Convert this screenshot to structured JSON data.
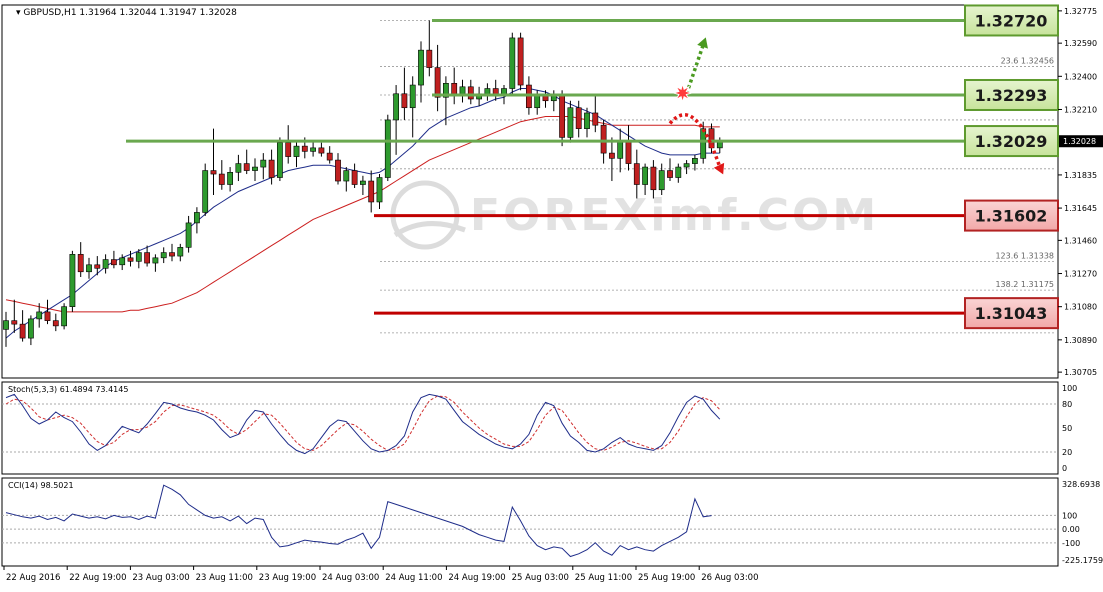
{
  "colors": {
    "bull": "#2e9a2e",
    "bear": "#c02020",
    "ma_fast": "#1f2d8a",
    "ma_slow": "#cc1f1f",
    "support": "#c00000",
    "resistance": "#6aa84f",
    "stoch_main": "#1f2d8a",
    "stoch_signal": "#d03030",
    "cci": "#1f2d8a",
    "fib": "#9a9a9a"
  },
  "chart_data": {
    "type": "candlestick",
    "header": {
      "symbol": "GBPUSD,H1",
      "open": "1.31964",
      "high": "1.32044",
      "low": "1.31947",
      "close": "1.32028"
    },
    "watermark": "FOREXimf.COM",
    "current_price": "1.32028",
    "ylim": [
      1.307,
      1.3278
    ],
    "price_ticks": [
      "1.32775",
      "1.32590",
      "1.32400",
      "1.32210",
      "1.32028",
      "1.31835",
      "1.31645",
      "1.31460",
      "1.31270",
      "1.31080",
      "1.30890",
      "1.30705"
    ],
    "x_ticks": [
      "22 Aug 2016",
      "22 Aug 19:00",
      "23 Aug 03:00",
      "23 Aug 11:00",
      "23 Aug 19:00",
      "24 Aug 03:00",
      "24 Aug 11:00",
      "24 Aug 19:00",
      "25 Aug 03:00",
      "25 Aug 11:00",
      "25 Aug 19:00",
      "26 Aug 03:00"
    ],
    "candles": [
      [
        1.3095,
        1.3105,
        1.3085,
        1.31
      ],
      [
        1.31,
        1.3112,
        1.3093,
        1.3098
      ],
      [
        1.3098,
        1.3106,
        1.3088,
        1.309
      ],
      [
        1.309,
        1.3103,
        1.3086,
        1.3101
      ],
      [
        1.3101,
        1.311,
        1.3096,
        1.3105
      ],
      [
        1.3105,
        1.3112,
        1.3098,
        1.31
      ],
      [
        1.31,
        1.3104,
        1.3094,
        1.3097
      ],
      [
        1.3097,
        1.311,
        1.3095,
        1.3108
      ],
      [
        1.3108,
        1.314,
        1.3105,
        1.3138
      ],
      [
        1.3138,
        1.3145,
        1.3125,
        1.3128
      ],
      [
        1.3128,
        1.3136,
        1.3124,
        1.3132
      ],
      [
        1.3132,
        1.3137,
        1.3126,
        1.313
      ],
      [
        1.313,
        1.3138,
        1.3127,
        1.3135
      ],
      [
        1.3135,
        1.314,
        1.313,
        1.3132
      ],
      [
        1.3132,
        1.3138,
        1.3129,
        1.3136
      ],
      [
        1.3136,
        1.314,
        1.3131,
        1.3134
      ],
      [
        1.3134,
        1.3141,
        1.313,
        1.3139
      ],
      [
        1.3139,
        1.3143,
        1.3131,
        1.3133
      ],
      [
        1.3133,
        1.3138,
        1.3128,
        1.3136
      ],
      [
        1.3136,
        1.3142,
        1.3133,
        1.3139
      ],
      [
        1.3139,
        1.3144,
        1.3134,
        1.3137
      ],
      [
        1.3137,
        1.3144,
        1.3134,
        1.3142
      ],
      [
        1.3142,
        1.316,
        1.3139,
        1.3156
      ],
      [
        1.3156,
        1.3165,
        1.315,
        1.3162
      ],
      [
        1.3162,
        1.319,
        1.316,
        1.3186
      ],
      [
        1.3186,
        1.321,
        1.3172,
        1.3184
      ],
      [
        1.3184,
        1.3192,
        1.3175,
        1.3178
      ],
      [
        1.3178,
        1.3188,
        1.3174,
        1.3185
      ],
      [
        1.3185,
        1.3195,
        1.318,
        1.319
      ],
      [
        1.319,
        1.3198,
        1.3184,
        1.3186
      ],
      [
        1.3186,
        1.3193,
        1.318,
        1.3188
      ],
      [
        1.3188,
        1.3196,
        1.3181,
        1.3192
      ],
      [
        1.3192,
        1.3198,
        1.3178,
        1.3182
      ],
      [
        1.3182,
        1.3205,
        1.318,
        1.3202
      ],
      [
        1.3202,
        1.3212,
        1.319,
        1.3194
      ],
      [
        1.3194,
        1.3203,
        1.3188,
        1.32
      ],
      [
        1.32,
        1.3205,
        1.3193,
        1.3197
      ],
      [
        1.3197,
        1.3203,
        1.3194,
        1.3199
      ],
      [
        1.3199,
        1.3202,
        1.3194,
        1.3196
      ],
      [
        1.3196,
        1.32,
        1.319,
        1.3192
      ],
      [
        1.3192,
        1.3196,
        1.3178,
        1.318
      ],
      [
        1.318,
        1.3188,
        1.3174,
        1.3186
      ],
      [
        1.3186,
        1.319,
        1.3176,
        1.3178
      ],
      [
        1.3178,
        1.3183,
        1.3172,
        1.318
      ],
      [
        1.318,
        1.3186,
        1.3162,
        1.3168
      ],
      [
        1.3168,
        1.3184,
        1.3164,
        1.3182
      ],
      [
        1.3182,
        1.3218,
        1.318,
        1.3215
      ],
      [
        1.3215,
        1.3235,
        1.3195,
        1.323
      ],
      [
        1.323,
        1.3245,
        1.3215,
        1.3222
      ],
      [
        1.3222,
        1.324,
        1.3205,
        1.3235
      ],
      [
        1.3235,
        1.326,
        1.3225,
        1.3255
      ],
      [
        1.3255,
        1.3272,
        1.324,
        1.3245
      ],
      [
        1.3245,
        1.3258,
        1.322,
        1.3228
      ],
      [
        1.3228,
        1.324,
        1.3212,
        1.3236
      ],
      [
        1.3236,
        1.3245,
        1.3224,
        1.323
      ],
      [
        1.323,
        1.3238,
        1.3225,
        1.3234
      ],
      [
        1.3234,
        1.3238,
        1.3224,
        1.3227
      ],
      [
        1.3227,
        1.3234,
        1.3223,
        1.323
      ],
      [
        1.323,
        1.3236,
        1.3226,
        1.3233
      ],
      [
        1.3233,
        1.3238,
        1.3226,
        1.3229
      ],
      [
        1.3229,
        1.3235,
        1.3224,
        1.3233
      ],
      [
        1.3233,
        1.3265,
        1.323,
        1.3262
      ],
      [
        1.3262,
        1.3265,
        1.3232,
        1.3235
      ],
      [
        1.3235,
        1.324,
        1.3218,
        1.3222
      ],
      [
        1.3222,
        1.3232,
        1.3218,
        1.3229
      ],
      [
        1.3229,
        1.3232,
        1.3222,
        1.3226
      ],
      [
        1.3226,
        1.3232,
        1.322,
        1.3229
      ],
      [
        1.3229,
        1.3232,
        1.32,
        1.3205
      ],
      [
        1.3205,
        1.3226,
        1.3202,
        1.3222
      ],
      [
        1.3222,
        1.3226,
        1.3205,
        1.321
      ],
      [
        1.321,
        1.3222,
        1.3205,
        1.3219
      ],
      [
        1.3219,
        1.323,
        1.3208,
        1.3212
      ],
      [
        1.3212,
        1.3215,
        1.319,
        1.3196
      ],
      [
        1.3196,
        1.3205,
        1.318,
        1.3193
      ],
      [
        1.3193,
        1.321,
        1.3185,
        1.3203
      ],
      [
        1.3203,
        1.3212,
        1.3186,
        1.319
      ],
      [
        1.319,
        1.3198,
        1.317,
        1.3178
      ],
      [
        1.3178,
        1.319,
        1.3172,
        1.3188
      ],
      [
        1.3188,
        1.3192,
        1.317,
        1.3175
      ],
      [
        1.3175,
        1.319,
        1.3172,
        1.3186
      ],
      [
        1.3186,
        1.3193,
        1.318,
        1.3182
      ],
      [
        1.3182,
        1.319,
        1.3179,
        1.3188
      ],
      [
        1.3188,
        1.3192,
        1.3184,
        1.319
      ],
      [
        1.319,
        1.3195,
        1.3186,
        1.3193
      ],
      [
        1.3193,
        1.3214,
        1.319,
        1.321
      ],
      [
        1.321,
        1.3213,
        1.3196,
        1.3199
      ],
      [
        1.3199,
        1.3205,
        1.3196,
        1.3203
      ]
    ],
    "ma_fast": [
      1.309,
      1.3094,
      1.3097,
      1.31,
      1.3103,
      1.3106,
      1.3109,
      1.3112,
      1.3115,
      1.3119,
      1.3123,
      1.3127,
      1.3131,
      1.3134,
      1.3136,
      1.3138,
      1.314,
      1.3142,
      1.3144,
      1.3146,
      1.3148,
      1.315,
      1.3153,
      1.3157,
      1.3161,
      1.3165,
      1.3168,
      1.3171,
      1.3174,
      1.3176,
      1.3178,
      1.318,
      1.3182,
      1.3184,
      1.3186,
      1.3187,
      1.3188,
      1.3189,
      1.3189,
      1.3189,
      1.3188,
      1.3187,
      1.3186,
      1.3185,
      1.3184,
      1.3185,
      1.3188,
      1.3192,
      1.3196,
      1.32,
      1.3205,
      1.321,
      1.3213,
      1.3216,
      1.3218,
      1.322,
      1.3222,
      1.3223,
      1.3225,
      1.3227,
      1.3228,
      1.3231,
      1.3233,
      1.3233,
      1.3232,
      1.3231,
      1.3229,
      1.3226,
      1.3224,
      1.3222,
      1.322,
      1.3218,
      1.3215,
      1.3212,
      1.3209,
      1.3206,
      1.3203,
      1.32,
      1.3198,
      1.3196,
      1.3195,
      1.3195,
      1.3195,
      1.3195,
      1.3196,
      1.3196,
      1.3196
    ],
    "ma_slow": [
      1.3112,
      1.3111,
      1.311,
      1.3109,
      1.3108,
      1.3107,
      1.3106,
      1.3105,
      1.3105,
      1.3105,
      1.3105,
      1.3105,
      1.3105,
      1.3105,
      1.3105,
      1.3106,
      1.3106,
      1.3107,
      1.3108,
      1.3109,
      1.311,
      1.3112,
      1.3114,
      1.3116,
      1.3119,
      1.3122,
      1.3125,
      1.3128,
      1.3131,
      1.3134,
      1.3137,
      1.314,
      1.3143,
      1.3146,
      1.3149,
      1.3152,
      1.3155,
      1.3158,
      1.316,
      1.3162,
      1.3164,
      1.3166,
      1.3168,
      1.317,
      1.3172,
      1.3174,
      1.3177,
      1.318,
      1.3183,
      1.3186,
      1.3189,
      1.3192,
      1.3194,
      1.3196,
      1.3198,
      1.32,
      1.3202,
      1.3204,
      1.3206,
      1.3208,
      1.321,
      1.3212,
      1.3214,
      1.3215,
      1.3216,
      1.3217,
      1.3217,
      1.3217,
      1.3217,
      1.3216,
      1.3215,
      1.3214,
      1.3213,
      1.3212,
      1.3212,
      1.3212,
      1.3212,
      1.3212,
      1.3212,
      1.3212,
      1.3212,
      1.3212,
      1.3212,
      1.3212,
      1.3211,
      1.3211,
      1.3211
    ],
    "levels": [
      {
        "label": "1.32720",
        "price": 1.3272,
        "kind": "resistance"
      },
      {
        "label": "1.32293",
        "price": 1.32293,
        "kind": "resistance"
      },
      {
        "label": "1.32029",
        "price": 1.32029,
        "kind": "resistance"
      },
      {
        "label": "1.31602",
        "price": 1.31602,
        "kind": "support"
      },
      {
        "label": "1.31043",
        "price": 1.31043,
        "kind": "support"
      }
    ],
    "fib_labels": [
      {
        "text": "23.6  1.32456",
        "price": 1.32456
      },
      {
        "text": "123.6  1.31338",
        "price": 1.31338
      },
      {
        "text": "138.2  1.31175",
        "price": 1.31175
      }
    ],
    "stoch": {
      "label": "Stoch(5,3,3) 61.4894 73.4145",
      "ticks": [
        "100",
        "80",
        "50",
        "20",
        "0"
      ],
      "main": [
        88,
        92,
        78,
        62,
        55,
        60,
        70,
        63,
        58,
        45,
        30,
        22,
        28,
        40,
        52,
        48,
        44,
        55,
        68,
        82,
        80,
        75,
        72,
        70,
        66,
        60,
        48,
        38,
        42,
        60,
        72,
        70,
        55,
        42,
        30,
        22,
        18,
        24,
        38,
        52,
        60,
        58,
        46,
        34,
        24,
        20,
        22,
        28,
        40,
        70,
        88,
        92,
        90,
        86,
        72,
        58,
        50,
        42,
        36,
        30,
        26,
        24,
        30,
        42,
        66,
        82,
        78,
        56,
        40,
        32,
        22,
        20,
        24,
        32,
        38,
        30,
        26,
        24,
        22,
        28,
        44,
        64,
        82,
        90,
        86,
        72,
        61
      ],
      "signal": [
        80,
        86,
        84,
        75,
        64,
        60,
        63,
        66,
        63,
        56,
        44,
        33,
        28,
        32,
        42,
        48,
        48,
        51,
        58,
        70,
        78,
        79,
        76,
        73,
        70,
        66,
        58,
        48,
        42,
        48,
        58,
        68,
        66,
        56,
        44,
        32,
        24,
        22,
        28,
        38,
        48,
        56,
        54,
        46,
        36,
        28,
        22,
        24,
        30,
        48,
        68,
        84,
        90,
        89,
        82,
        70,
        60,
        50,
        42,
        36,
        30,
        27,
        27,
        33,
        48,
        66,
        76,
        72,
        58,
        44,
        32,
        24,
        22,
        26,
        32,
        34,
        31,
        27,
        24,
        24,
        32,
        46,
        64,
        80,
        88,
        84,
        73
      ]
    },
    "cci": {
      "label": "CCI(14) 98.5021",
      "ticks": [
        "328.6938",
        "100",
        "0.00",
        "-100",
        "-225.1759"
      ],
      "values": [
        120,
        105,
        90,
        80,
        95,
        70,
        85,
        60,
        110,
        95,
        80,
        90,
        75,
        100,
        85,
        90,
        70,
        95,
        80,
        320,
        290,
        250,
        180,
        140,
        100,
        80,
        90,
        60,
        95,
        40,
        80,
        70,
        -60,
        -130,
        -120,
        -100,
        -80,
        -90,
        -95,
        -105,
        -110,
        -80,
        -60,
        -30,
        -140,
        -60,
        200,
        180,
        160,
        140,
        120,
        100,
        80,
        60,
        40,
        20,
        -10,
        -40,
        -60,
        -80,
        -90,
        160,
        60,
        -50,
        -120,
        -150,
        -130,
        -140,
        -200,
        -180,
        -150,
        -100,
        -160,
        -190,
        -120,
        -150,
        -130,
        -150,
        -160,
        -120,
        -90,
        -60,
        -20,
        220,
        90,
        98.5
      ]
    },
    "arrows": [
      {
        "from": [
          1.323,
          82
        ],
        "to": [
          1.3258,
          84
        ],
        "color": "green"
      },
      {
        "from": [
          1.3213,
          80
        ],
        "to": [
          1.3188,
          86
        ],
        "color": "red"
      }
    ]
  }
}
